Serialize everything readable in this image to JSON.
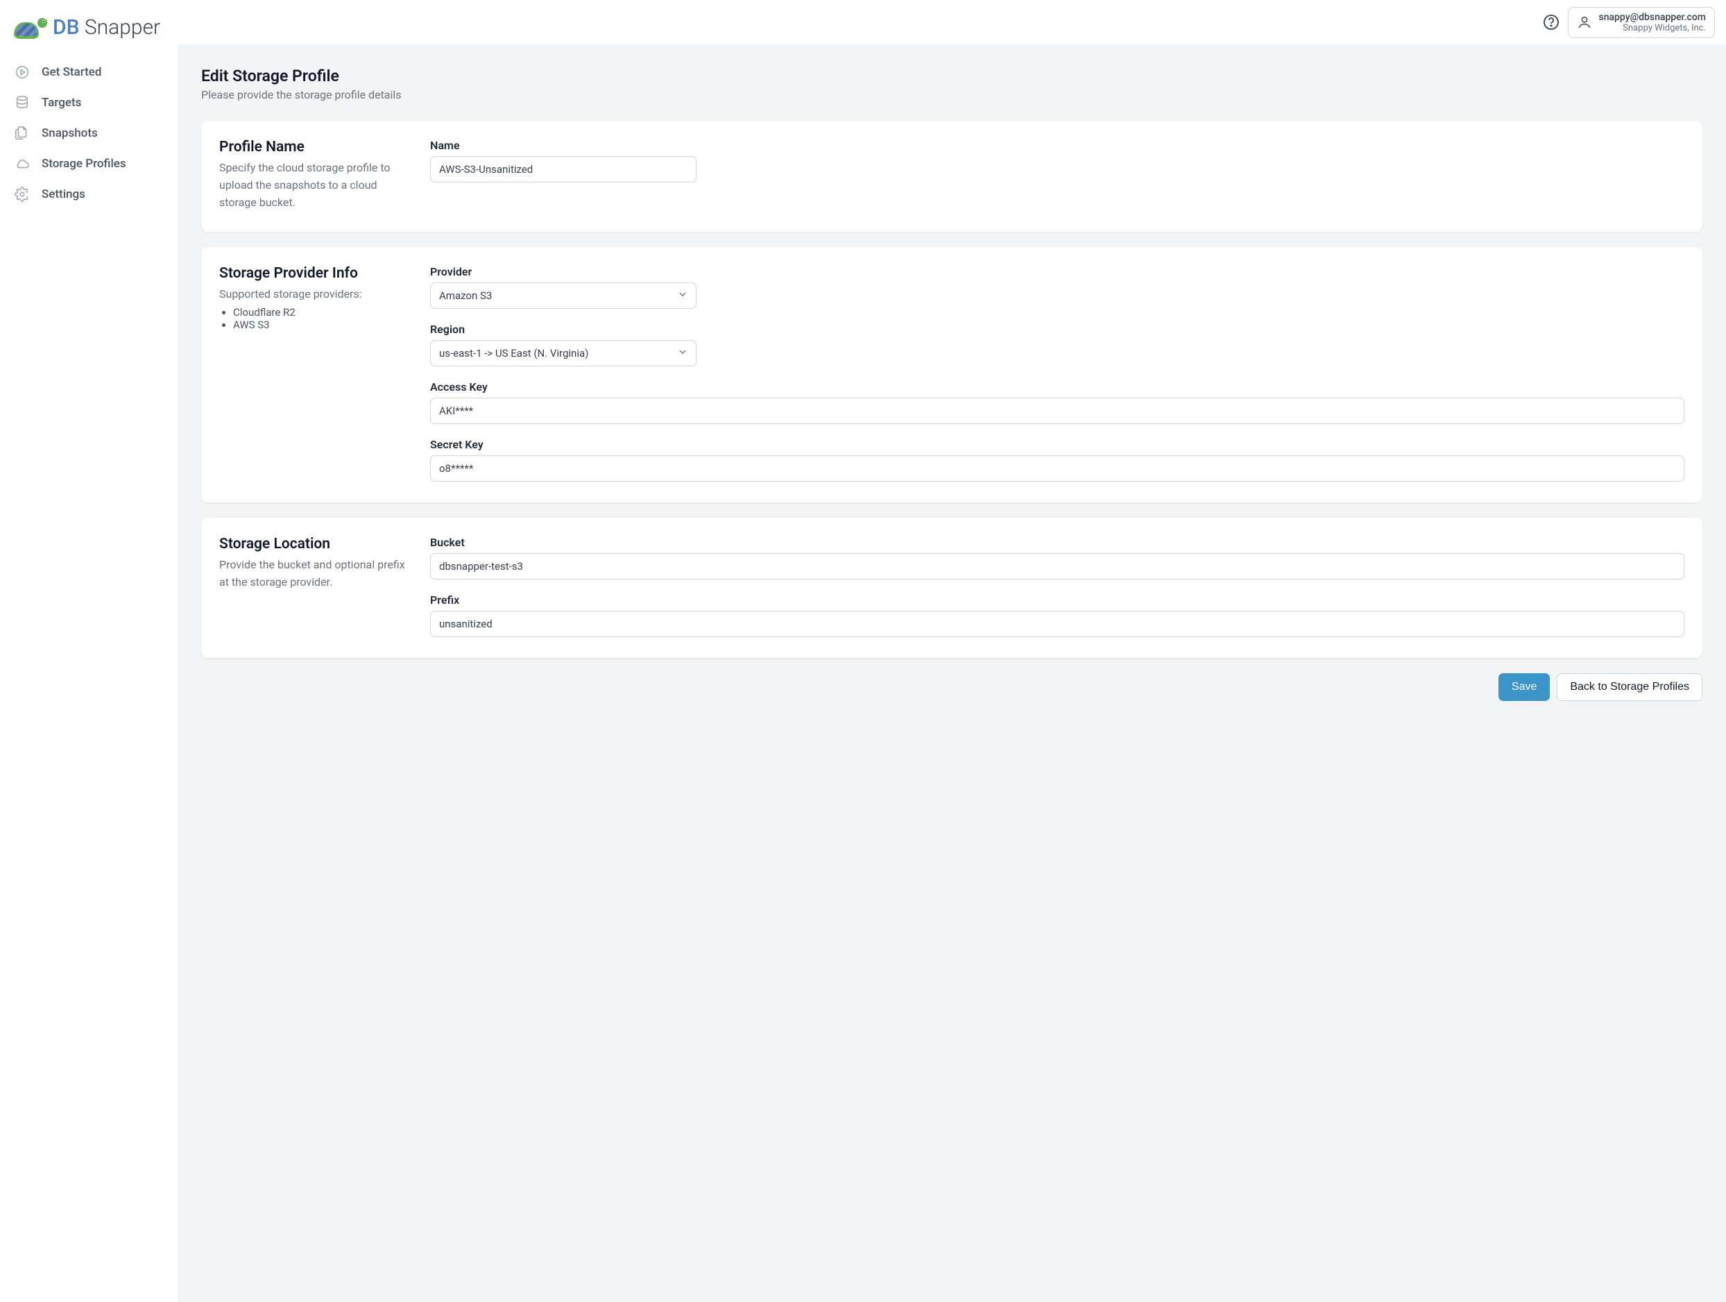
{
  "app": {
    "name_part1": "DB",
    "name_part2": " Snapper"
  },
  "sidebar": {
    "items": [
      {
        "label": "Get Started",
        "icon": "play-circle"
      },
      {
        "label": "Targets",
        "icon": "database"
      },
      {
        "label": "Snapshots",
        "icon": "documents"
      },
      {
        "label": "Storage Profiles",
        "icon": "cloud"
      },
      {
        "label": "Settings",
        "icon": "gear"
      }
    ]
  },
  "header": {
    "user_email": "snappy@dbsnapper.com",
    "user_org": "Snappy Widgets, Inc."
  },
  "page": {
    "title": "Edit Storage Profile",
    "subtitle": "Please provide the storage profile details"
  },
  "sections": {
    "profile_name": {
      "title": "Profile Name",
      "desc": "Specify the cloud storage profile to upload the snapshots to a cloud storage bucket.",
      "name_label": "Name",
      "name_value": "AWS-S3-Unsanitized"
    },
    "provider_info": {
      "title": "Storage Provider Info",
      "desc": "Supported storage providers:",
      "providers_list": [
        "Cloudflare R2",
        "AWS S3"
      ],
      "provider_label": "Provider",
      "provider_value": "Amazon S3",
      "region_label": "Region",
      "region_value": "us-east-1 -> US East (N. Virginia)",
      "access_key_label": "Access Key",
      "access_key_value": "AKI****",
      "secret_key_label": "Secret Key",
      "secret_key_value": "o8*****"
    },
    "storage_location": {
      "title": "Storage Location",
      "desc": "Provide the bucket and optional prefix at the storage provider.",
      "bucket_label": "Bucket",
      "bucket_value": "dbsnapper-test-s3",
      "prefix_label": "Prefix",
      "prefix_value": "unsanitized"
    }
  },
  "actions": {
    "save_label": "Save",
    "back_label": "Back to Storage Profiles"
  }
}
